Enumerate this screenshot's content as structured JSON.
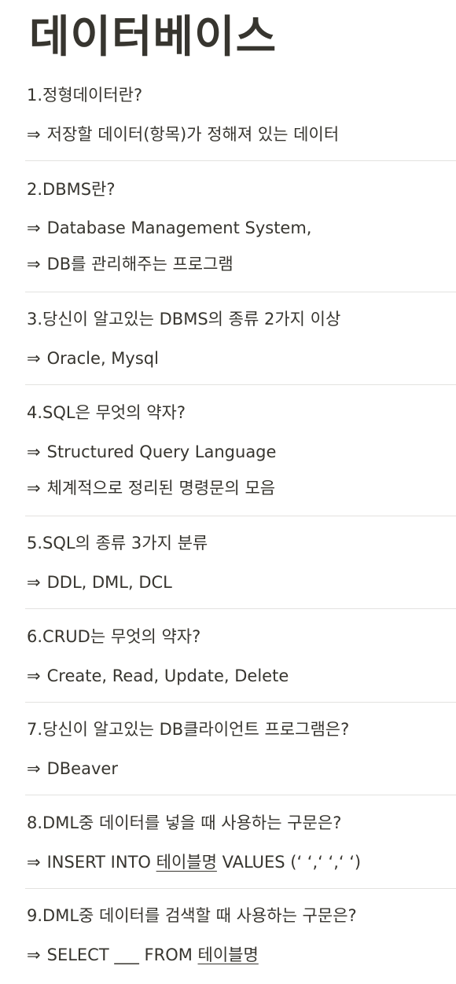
{
  "title": "데이터베이스",
  "arrow": "⇒",
  "qa": [
    {
      "q": "1.정형데이터란?",
      "a": [
        "저장할 데이터(항목)가 정해져 있는 데이터"
      ]
    },
    {
      "q": "2.DBMS란?",
      "a": [
        "Database Management System,",
        "DB를 관리해주는 프로그램"
      ]
    },
    {
      "q": "3.당신이 알고있는 DBMS의 종류 2가지 이상",
      "a": [
        "Oracle, Mysql"
      ]
    },
    {
      "q": "4.SQL은 무엇의 약자?",
      "a": [
        "Structured Query Language",
        "체계적으로 정리된 명령문의 모음"
      ]
    },
    {
      "q": "5.SQL의 종류 3가지 분류",
      "a": [
        "DDL, DML, DCL"
      ]
    },
    {
      "q": "6.CRUD는 무엇의 약자?",
      "a": [
        "Create, Read, Update, Delete"
      ]
    },
    {
      "q": "7.당신이 알고있는 DB클라이언트 프로그램은?",
      "a": [
        "DBeaver"
      ]
    },
    {
      "q": "8.DML중 데이터를 넣을 때 사용하는 구문은?",
      "a8": {
        "pre": "INSERT INTO ",
        "ul": "테이블명",
        "post": " VALUES (‘ ‘,‘ ‘,‘ ‘)"
      }
    },
    {
      "q": "9.DML중 데이터를 검색할 때 사용하는 구문은?",
      "a9": {
        "pre": "SELECT ___ FROM ",
        "ul": "테이블명"
      }
    }
  ]
}
